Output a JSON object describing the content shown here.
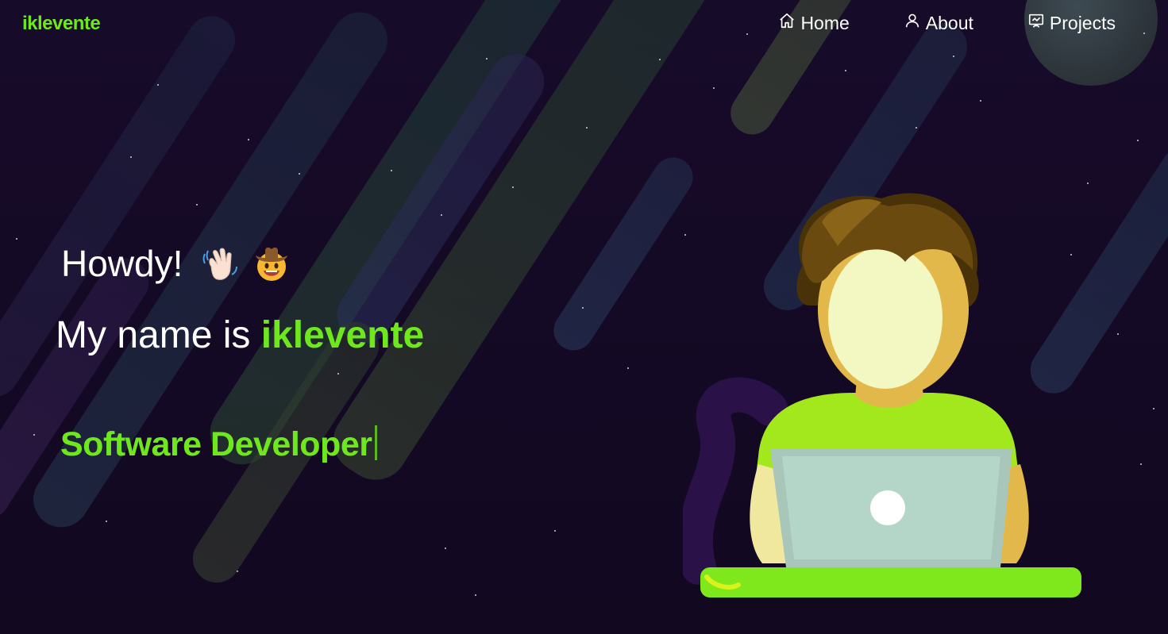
{
  "brand": {
    "logo": "iklevente"
  },
  "nav": {
    "items": [
      {
        "label": "Home",
        "icon": "home-icon"
      },
      {
        "label": "About",
        "icon": "user-icon"
      },
      {
        "label": "Projects",
        "icon": "projects-icon"
      }
    ]
  },
  "hero": {
    "greeting": "Howdy!",
    "greeting_emojis": [
      "waving-hand-icon",
      "cowboy-face-icon"
    ],
    "intro_prefix": "My name is ",
    "name": "iklevente",
    "role": "Software Developer"
  },
  "colors": {
    "accent": "#6ee81d",
    "background": "#140a24",
    "text": "#ffffff"
  }
}
